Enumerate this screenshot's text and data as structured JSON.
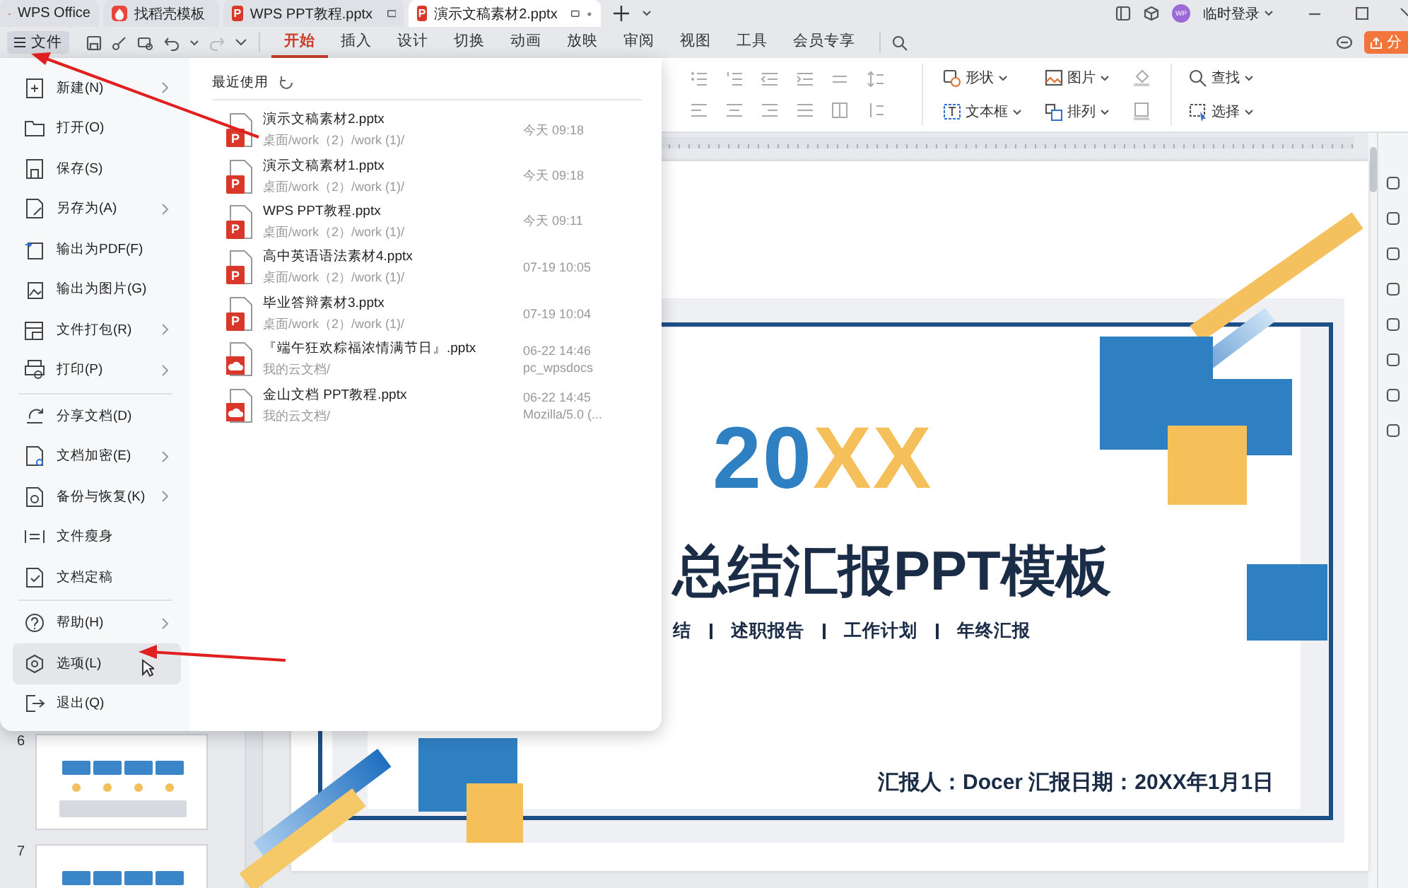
{
  "title_tabs": [
    {
      "label": "WPS Office",
      "kind": "home",
      "selected": false
    },
    {
      "label": "找稻壳模板",
      "kind": "docer",
      "selected": false
    },
    {
      "label": "WPS PPT教程.pptx",
      "kind": "ppt",
      "icon_label": "P",
      "selected": false
    },
    {
      "label": "演示文稿素材2.pptx",
      "kind": "ppt",
      "icon_label": "P",
      "selected": true
    }
  ],
  "account": {
    "avatar": "WP",
    "name": "临时登录"
  },
  "file_button": {
    "label": "文件"
  },
  "ribbon_tabs": [
    {
      "label": "开始",
      "selected": true
    },
    {
      "label": "插入",
      "selected": false
    },
    {
      "label": "设计",
      "selected": false
    },
    {
      "label": "切换",
      "selected": false
    },
    {
      "label": "动画",
      "selected": false
    },
    {
      "label": "放映",
      "selected": false
    },
    {
      "label": "审阅",
      "selected": false
    },
    {
      "label": "视图",
      "selected": false
    },
    {
      "label": "工具",
      "selected": false
    },
    {
      "label": "会员专享",
      "selected": false
    }
  ],
  "share_button": {
    "label": "分"
  },
  "ribbon_tools": [
    {
      "label": "形状",
      "kind": "shape"
    },
    {
      "label": "图片",
      "kind": "picture"
    },
    {
      "label": "查找",
      "kind": "find"
    },
    {
      "label": "文本框",
      "kind": "textbox"
    },
    {
      "label": "排列",
      "kind": "arrange"
    },
    {
      "label": "选择",
      "kind": "select"
    }
  ],
  "file_menu": {
    "groups": [
      {
        "items": [
          {
            "label": "新建(N)",
            "has_submenu": true,
            "selected": false
          },
          {
            "label": "打开(O)",
            "has_submenu": false,
            "selected": false
          },
          {
            "label": "保存(S)",
            "has_submenu": false,
            "selected": false
          },
          {
            "label": "另存为(A)",
            "has_submenu": true,
            "selected": false
          },
          {
            "label": "输出为PDF(F)",
            "has_submenu": false,
            "selected": false
          },
          {
            "label": "输出为图片(G)",
            "has_submenu": false,
            "selected": false
          },
          {
            "label": "文件打包(R)",
            "has_submenu": true,
            "selected": false
          },
          {
            "label": "打印(P)",
            "has_submenu": true,
            "selected": false
          }
        ]
      },
      {
        "items": [
          {
            "label": "分享文档(D)",
            "has_submenu": false,
            "selected": false
          },
          {
            "label": "文档加密(E)",
            "has_submenu": true,
            "selected": false
          },
          {
            "label": "备份与恢复(K)",
            "has_submenu": true,
            "selected": false
          },
          {
            "label": "文件瘦身",
            "has_submenu": false,
            "selected": false
          },
          {
            "label": "文档定稿",
            "has_submenu": false,
            "selected": false
          }
        ]
      },
      {
        "items": [
          {
            "label": "帮助(H)",
            "has_submenu": true,
            "selected": false
          },
          {
            "label": "选项(L)",
            "has_submenu": false,
            "selected": true
          },
          {
            "label": "退出(Q)",
            "has_submenu": false,
            "selected": false
          }
        ]
      }
    ],
    "recent": {
      "title": "最近使用",
      "files": [
        {
          "name": "演示文稿素材2.pptx",
          "location": "桌面/work（2）/work (1)/",
          "time": "今天  09:18",
          "kind": "local",
          "icon_label": "P"
        },
        {
          "name": "演示文稿素材1.pptx",
          "location": "桌面/work（2）/work (1)/",
          "time": "今天  09:18",
          "kind": "local",
          "icon_label": "P"
        },
        {
          "name": "WPS PPT教程.pptx",
          "location": "桌面/work（2）/work (1)/",
          "time": "今天  09:11",
          "kind": "local",
          "icon_label": "P"
        },
        {
          "name": "高中英语语法素材4.pptx",
          "location": "桌面/work（2）/work (1)/",
          "time": "07-19 10:05",
          "kind": "local",
          "icon_label": "P"
        },
        {
          "name": "毕业答辩素材3.pptx",
          "location": "桌面/work（2）/work (1)/",
          "time": "07-19 10:04",
          "kind": "local",
          "icon_label": "P"
        },
        {
          "name": "『端午狂欢粽福浓情满节日』.pptx",
          "location": "我的云文档/",
          "time": "06-22 14:46",
          "source": "pc_wpsdocs",
          "kind": "cloud"
        },
        {
          "name": "金山文档 PPT教程.pptx",
          "location": "我的云文档/",
          "time": "06-22 14:45",
          "source": "Mozilla/5.0 (...",
          "kind": "cloud"
        }
      ]
    }
  },
  "slide_thumbnails": [
    {
      "number": "6"
    },
    {
      "number": "7"
    }
  ],
  "slide": {
    "year_prefix": "20",
    "year_suffix": "XX",
    "title": "总结汇报PPT模板",
    "subtitles": [
      "结",
      "述职报告",
      "工作计划",
      "年终汇报"
    ],
    "reporter": "汇报人：Docer  汇报日期：20XX年1月1日"
  }
}
